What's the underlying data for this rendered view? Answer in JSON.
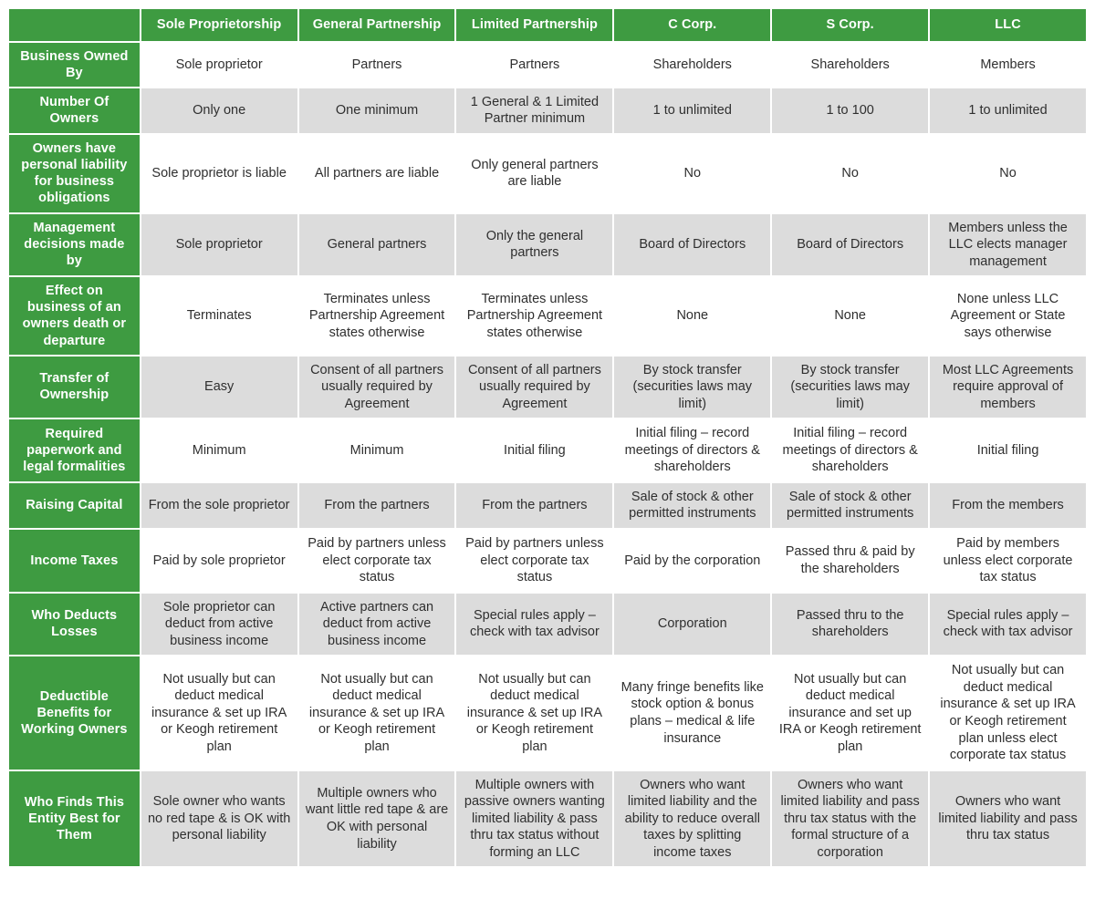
{
  "table": {
    "corner_label": "",
    "columns": [
      "Sole Proprietorship",
      "General Partnership",
      "Limited Partnership",
      "C Corp.",
      "S Corp.",
      "LLC"
    ],
    "colors": {
      "header_green": "#3e9b41",
      "row_gray": "#dcdcdc",
      "row_white": "#ffffff",
      "header_text": "#ffffff",
      "cell_text": "#2f2f2f"
    },
    "rows": [
      {
        "label": "Business Owned By",
        "shade": "white",
        "cells": [
          "Sole proprietor",
          "Partners",
          "Partners",
          "Shareholders",
          "Shareholders",
          "Members"
        ]
      },
      {
        "label": "Number Of Owners",
        "shade": "gray",
        "cells": [
          "Only one",
          "One minimum",
          "1 General & 1 Limited Partner minimum",
          "1 to unlimited",
          "1 to 100",
          "1 to unlimited"
        ]
      },
      {
        "label": "Owners have personal liability for business obligations",
        "shade": "white",
        "cells": [
          "Sole proprietor is liable",
          "All partners are liable",
          "Only general partners are liable",
          "No",
          "No",
          "No"
        ]
      },
      {
        "label": "Management decisions made by",
        "shade": "gray",
        "cells": [
          "Sole proprietor",
          "General partners",
          "Only the general partners",
          "Board of Directors",
          "Board of Directors",
          "Members unless the LLC elects manager management"
        ]
      },
      {
        "label": "Effect on business of an owners death or departure",
        "shade": "white",
        "cells": [
          "Terminates",
          "Terminates unless Partnership Agreement states otherwise",
          "Terminates unless Partnership Agreement states otherwise",
          "None",
          "None",
          "None unless LLC Agreement or State says otherwise"
        ]
      },
      {
        "label": "Transfer of Ownership",
        "shade": "gray",
        "cells": [
          "Easy",
          "Consent of all partners usually required by Agreement",
          "Consent of all partners usually required by Agreement",
          "By stock transfer (securities laws may limit)",
          "By stock transfer (securities laws may limit)",
          "Most LLC Agreements require approval of members"
        ]
      },
      {
        "label": "Required paperwork and legal formalities",
        "shade": "white",
        "cells": [
          "Minimum",
          "Minimum",
          "Initial filing",
          "Initial filing – record meetings of directors & shareholders",
          "Initial filing – record meetings of directors & shareholders",
          "Initial filing"
        ]
      },
      {
        "label": "Raising Capital",
        "shade": "gray",
        "cells": [
          "From the sole proprietor",
          "From the partners",
          "From the partners",
          "Sale of stock & other permitted instruments",
          "Sale of stock & other permitted instruments",
          "From the members"
        ]
      },
      {
        "label": "Income Taxes",
        "shade": "white",
        "cells": [
          "Paid by sole proprietor",
          "Paid by partners unless elect corporate tax status",
          "Paid by partners unless elect corporate tax status",
          "Paid by the corporation",
          "Passed thru & paid by the shareholders",
          "Paid by members unless elect corporate tax status"
        ]
      },
      {
        "label": "Who Deducts Losses",
        "shade": "gray",
        "cells": [
          "Sole proprietor can deduct from active business income",
          "Active partners can deduct from active business income",
          "Special rules apply – check with tax advisor",
          "Corporation",
          "Passed thru to the shareholders",
          "Special rules apply – check with tax advisor"
        ]
      },
      {
        "label": "Deductible Benefits for Working Owners",
        "shade": "white",
        "cells": [
          "Not usually but can deduct medical insurance & set up IRA or Keogh retirement plan",
          "Not usually but can deduct medical insurance  & set up IRA or Keogh retirement plan",
          "Not usually but can deduct medical insurance & set up IRA or Keogh retirement plan",
          "Many fringe benefits like stock option & bonus plans – medical & life insurance",
          "Not usually but can deduct medical insurance and set up IRA or Keogh retirement plan",
          "Not usually but can deduct medical insurance & set up IRA or Keogh retirement plan unless elect corporate tax status"
        ]
      },
      {
        "label": "Who Finds This Entity Best for Them",
        "shade": "gray",
        "cells": [
          "Sole owner who wants no red tape & is OK with personal liability",
          "Multiple owners who want little red tape & are OK with personal liability",
          "Multiple owners with passive owners wanting limited liability & pass thru tax status without forming an LLC",
          "Owners who want limited liability and the ability to reduce overall taxes by splitting income taxes",
          "Owners who want limited liability and pass thru tax status with the formal structure of a corporation",
          "Owners who want limited liability and pass thru tax status"
        ]
      }
    ]
  }
}
